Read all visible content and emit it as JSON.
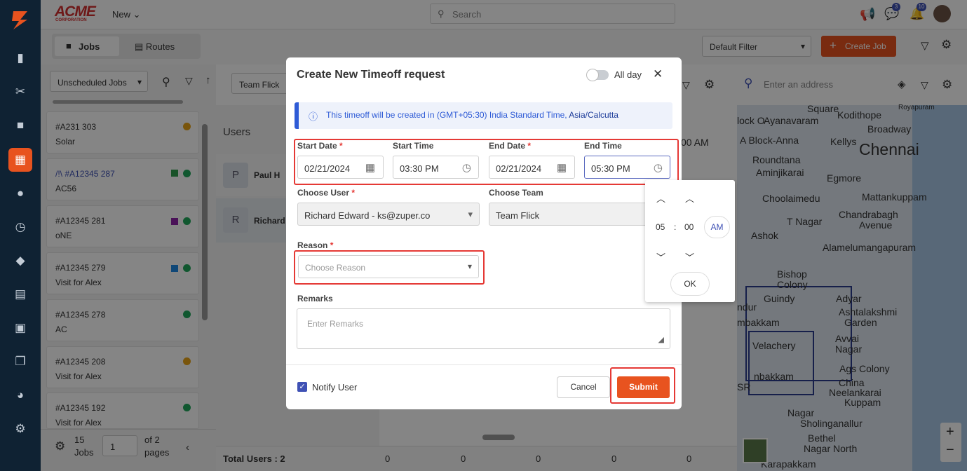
{
  "brand": {
    "logo_text": "ACME",
    "logo_sub": "CORPORATION",
    "new_label": "New"
  },
  "search": {
    "placeholder": "Search"
  },
  "header": {
    "badge_chat": "3",
    "badge_bell": "10"
  },
  "toolbar": {
    "tab_jobs": "Jobs",
    "tab_routes": "Routes",
    "filter_label": "Default Filter",
    "create_job": "Create Job"
  },
  "left": {
    "dropdown": "Unscheduled Jobs",
    "jobs": [
      {
        "id": "#A231 303",
        "name": "Solar"
      },
      {
        "id": "/!\\ #A12345 287",
        "name": "AC56"
      },
      {
        "id": "#A12345 281",
        "name": "oNE"
      },
      {
        "id": "#A12345 279",
        "name": "Visit for Alex"
      },
      {
        "id": "#A12345 278",
        "name": "AC"
      },
      {
        "id": "#A12345 208",
        "name": "Visit for Alex"
      },
      {
        "id": "#A12345 192",
        "name": "Visit for Alex"
      }
    ],
    "footer_count": "15",
    "footer_jobs": "Jobs",
    "page_value": "1",
    "of_pages": "of 2",
    "pages": "pages"
  },
  "middle": {
    "team": "Team Flick",
    "users_title": "Users",
    "users": [
      {
        "initial": "P",
        "name": "Paul H"
      },
      {
        "initial": "R",
        "name": "Richard I"
      }
    ],
    "time_label": "00 AM",
    "total": "Total Users : 2",
    "zeros": [
      "0",
      "0",
      "0",
      "0",
      "0"
    ]
  },
  "map": {
    "placeholder": "Enter an address",
    "labels": [
      "Square",
      "Kodithope",
      "Royapuram",
      "lock O",
      "Ayanavaram",
      "Broadway",
      "A Block-Anna",
      "Kellys",
      "Chennai",
      "Roundtana",
      "Aminjikarai",
      "Egmore",
      "Choolaimedu",
      "Mattankuppam",
      "T Nagar",
      "Chandrabagh",
      "Avenue",
      "Ashok",
      "Alamelumangapuram",
      "Bishop",
      "Colony",
      "Guindy",
      "Adyar",
      "Ashtalakshmi",
      "Garden",
      "Velachery",
      "Avvai",
      "Nagar",
      "Ags Colony",
      "China",
      "Neelankarai",
      "Kuppam",
      "Nagar",
      "Sholinganallur",
      "Bethel",
      "Nagar North",
      "Karapakkam",
      "ndur",
      "mbakkam",
      "nbakkam",
      "SR"
    ],
    "zoom_in": "+",
    "zoom_out": "−"
  },
  "modal": {
    "title": "Create New Timeoff request",
    "allday": "All day",
    "info_prefix": "This timeoff will be created in (GMT+05:30) India Standard Time, ",
    "info_tz": "Asia/Calcutta",
    "start_date_label": "Start Date",
    "start_time_label": "Start Time",
    "end_date_label": "End Date",
    "end_time_label": "End Time",
    "start_date": "02/21/2024",
    "start_time": "03:30 PM",
    "end_date": "02/21/2024",
    "end_time": "05:30 PM",
    "user_label": "Choose User",
    "user_value": "Richard Edward - ks@zuper.co",
    "team_label": "Choose Team",
    "team_value": "Team Flick",
    "reason_label": "Reason",
    "reason_placeholder": "Choose Reason",
    "remarks_label": "Remarks",
    "remarks_placeholder": "Enter Remarks",
    "notify": "Notify User",
    "cancel": "Cancel",
    "submit": "Submit",
    "required_mark": "*"
  },
  "timepicker": {
    "hour": "05",
    "sep": ":",
    "minute": "00",
    "ampm": "AM",
    "ok": "OK"
  },
  "colors": {
    "accent": "#e8531f",
    "sidebar": "#0f2233",
    "red_box": "#e53935",
    "info": "#2e5bd6"
  }
}
